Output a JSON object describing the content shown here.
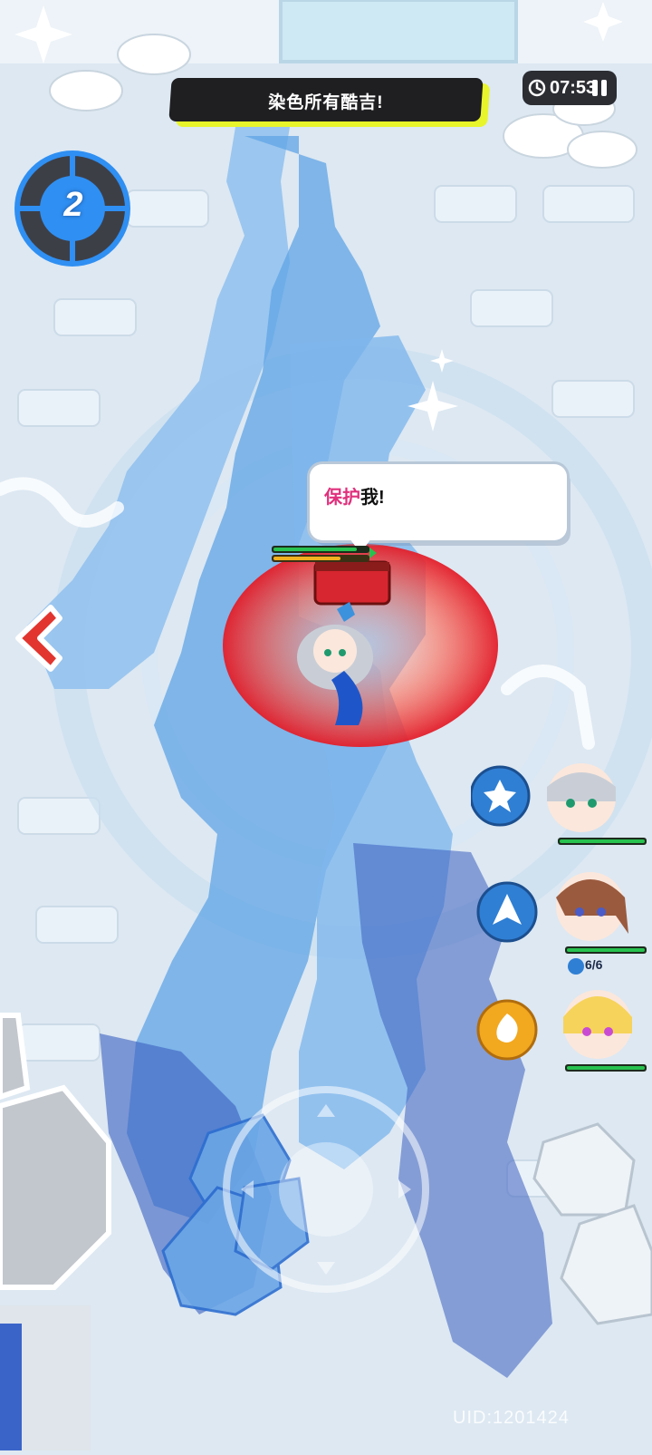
{
  "objective": {
    "text": "染色所有酷吉!"
  },
  "timer": {
    "time": "07:53",
    "icon": "clock-icon",
    "pause_icon": "pause-icon"
  },
  "level_badge": {
    "value": "2"
  },
  "speech_bubble": {
    "highlight": "保护",
    "rest": "我!"
  },
  "squad": {
    "members": [
      {
        "name_hidden": true,
        "skill_icon": "skill-icon-flower",
        "health_fraction": 1.0
      },
      {
        "name_hidden": true,
        "skill_icon": "skill-icon-arrows",
        "health_fraction": 1.0,
        "counter": "6/6"
      },
      {
        "name_hidden": true,
        "skill_icon": "skill-icon-swirl",
        "health_fraction": 1.0
      }
    ]
  },
  "player": {
    "health_fraction": 0.85,
    "shield_fraction": 0.7
  },
  "uid": {
    "text": "UID:1201424"
  },
  "colors": {
    "ink_blue": "#3f8ee0",
    "pink": "#e0307c",
    "banner_yellow": "#e8f52a",
    "health_green": "#27c24f"
  }
}
